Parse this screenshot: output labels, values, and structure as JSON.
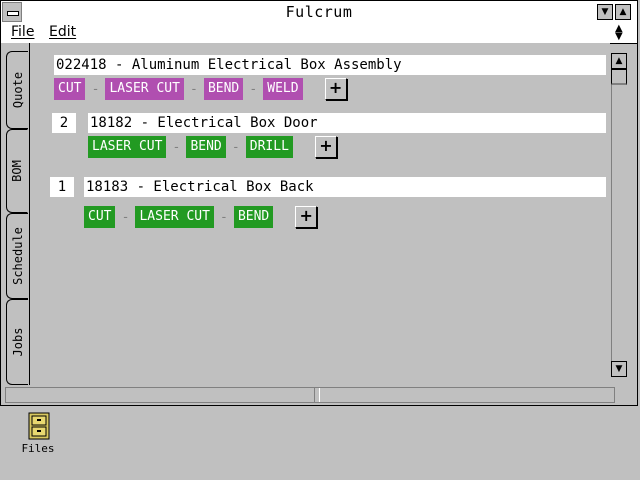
{
  "window": {
    "title": "Fulcrum"
  },
  "menu": {
    "file": "File",
    "edit": "Edit"
  },
  "tabs": [
    "Quote",
    "BOM",
    "Schedule",
    "Jobs"
  ],
  "active_tab": "BOM",
  "colors": {
    "assembly_step": "#b04fb0",
    "part_step": "#229a22"
  },
  "bom": {
    "assembly": {
      "title": "022418 - Aluminum Electrical Box Assembly",
      "steps": [
        "CUT",
        "LASER CUT",
        "BEND",
        "WELD"
      ],
      "separator": "-",
      "add": "+"
    },
    "parts": [
      {
        "qty": "2",
        "title": "18182 - Electrical Box Door",
        "steps": [
          "LASER CUT",
          "BEND",
          "DRILL"
        ],
        "add": "+"
      },
      {
        "qty": "1",
        "title": "18183 - Electrical Box Back",
        "steps": [
          "CUT",
          "LASER CUT",
          "BEND"
        ],
        "add": "+"
      }
    ]
  },
  "desktop": {
    "icon": "file-cabinet-icon",
    "label": "Files"
  }
}
